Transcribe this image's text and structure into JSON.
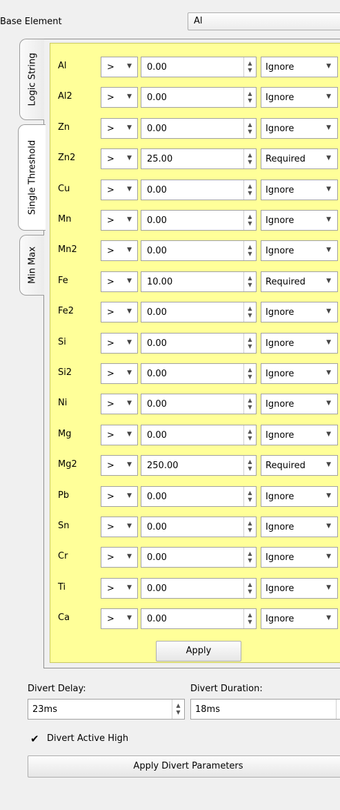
{
  "base_element": {
    "label": "Base Element",
    "value": "Al"
  },
  "tabs": [
    {
      "label": "Logic String",
      "active": false
    },
    {
      "label": "Single Threshold",
      "active": true
    },
    {
      "label": "Min Max",
      "active": false
    }
  ],
  "rows": [
    {
      "element": "Al",
      "op": ">",
      "value": "0.00",
      "mode": "Ignore"
    },
    {
      "element": "Al2",
      "op": ">",
      "value": "0.00",
      "mode": "Ignore"
    },
    {
      "element": "Zn",
      "op": ">",
      "value": "0.00",
      "mode": "Ignore"
    },
    {
      "element": "Zn2",
      "op": ">",
      "value": "25.00",
      "mode": "Required"
    },
    {
      "element": "Cu",
      "op": ">",
      "value": "0.00",
      "mode": "Ignore"
    },
    {
      "element": "Mn",
      "op": ">",
      "value": "0.00",
      "mode": "Ignore"
    },
    {
      "element": "Mn2",
      "op": ">",
      "value": "0.00",
      "mode": "Ignore"
    },
    {
      "element": "Fe",
      "op": ">",
      "value": "10.00",
      "mode": "Required"
    },
    {
      "element": "Fe2",
      "op": ">",
      "value": "0.00",
      "mode": "Ignore"
    },
    {
      "element": "Si",
      "op": ">",
      "value": "0.00",
      "mode": "Ignore"
    },
    {
      "element": "Si2",
      "op": ">",
      "value": "0.00",
      "mode": "Ignore"
    },
    {
      "element": "Ni",
      "op": ">",
      "value": "0.00",
      "mode": "Ignore"
    },
    {
      "element": "Mg",
      "op": ">",
      "value": "0.00",
      "mode": "Ignore"
    },
    {
      "element": "Mg2",
      "op": ">",
      "value": "250.00",
      "mode": "Required"
    },
    {
      "element": "Pb",
      "op": ">",
      "value": "0.00",
      "mode": "Ignore"
    },
    {
      "element": "Sn",
      "op": ">",
      "value": "0.00",
      "mode": "Ignore"
    },
    {
      "element": "Cr",
      "op": ">",
      "value": "0.00",
      "mode": "Ignore"
    },
    {
      "element": "Ti",
      "op": ">",
      "value": "0.00",
      "mode": "Ignore"
    },
    {
      "element": "Ca",
      "op": ">",
      "value": "0.00",
      "mode": "Ignore"
    }
  ],
  "apply_label": "Apply",
  "divert": {
    "delay_label": "Divert Delay:",
    "delay_value": "23ms",
    "duration_label": "Divert Duration:",
    "duration_value": "18ms",
    "active_high_label": "Divert Active High",
    "active_high_checked": true,
    "apply_label": "Apply Divert Parameters"
  },
  "icons": {
    "dropdown": "chevron-down-icon",
    "spin": "spin-up-down-icon",
    "check": "checkmark-icon"
  },
  "colors": {
    "panel_background": "#ffff99",
    "window_background": "#f0f0f0"
  }
}
